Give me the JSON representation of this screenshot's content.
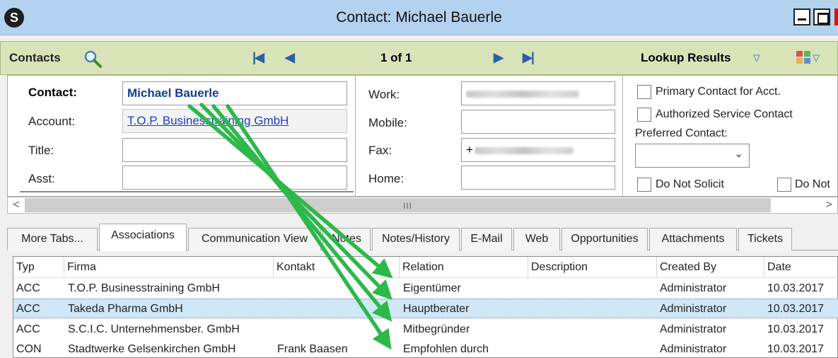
{
  "window": {
    "app_icon": "S",
    "title": "Contact: Michael Bauerle"
  },
  "toolbar": {
    "contacts_label": "Contacts",
    "record_position": "1 of 1",
    "lookup_label": "Lookup Results"
  },
  "form": {
    "contact_label": "Contact:",
    "contact_value": "Michael Bauerle",
    "account_label": "Account:",
    "account_value": "T.O.P. Businesstraining GmbH",
    "title_label": "Title:",
    "title_value": "",
    "asst_label": "Asst:",
    "asst_value": "",
    "work_label": "Work:",
    "mobile_label": "Mobile:",
    "fax_label": "Fax:",
    "fax_prefix": "+",
    "home_label": "Home:",
    "primary_contact_label": "Primary Contact for Acct.",
    "authorized_service_label": "Authorized Service Contact",
    "preferred_contact_label": "Preferred Contact:",
    "preferred_contact_value": "",
    "do_not_solicit_label": "Do Not Solicit",
    "do_not_label": "Do Not"
  },
  "tabs": [
    "More Tabs...",
    "Associations",
    "Communication View",
    "Notes",
    "Notes/History",
    "E-Mail",
    "Web",
    "Opportunities",
    "Attachments",
    "Tickets"
  ],
  "grid": {
    "columns": [
      "Typ",
      "Firma",
      "Kontakt",
      "Relation",
      "Description",
      "Created By",
      "Date"
    ],
    "rows": [
      [
        "ACC",
        "T.O.P. Businesstraining GmbH",
        "",
        "Eigentümer",
        "",
        "Administrator",
        "10.03.2017"
      ],
      [
        "ACC",
        "Takeda Pharma GmbH",
        "",
        "Hauptberater",
        "",
        "Administrator",
        "10.03.2017"
      ],
      [
        "ACC",
        "S.C.I.C. Unternehmensber. GmbH",
        "",
        "Mitbegründer",
        "",
        "Administrator",
        "10.03.2017"
      ],
      [
        "CON",
        "Stadtwerke Gelsenkirchen GmbH",
        "Frank Baasen",
        "Empfohlen durch",
        "",
        "Administrator",
        "10.03.2017"
      ]
    ],
    "selected_row": 1
  },
  "colors": {
    "titlebar": "#b2d2f0",
    "toolbar": "#d8e4b8",
    "selected_row": "#cfe7f7",
    "annotation_arrow": "#2db84a"
  },
  "icons": [
    "app-logo-icon",
    "search-icon",
    "first-record-icon",
    "previous-record-icon",
    "next-record-icon",
    "last-record-icon",
    "dropdown-arrow-icon",
    "layout-icon",
    "minimize-icon",
    "maximize-icon",
    "scroll-left-icon",
    "scroll-right-icon"
  ]
}
